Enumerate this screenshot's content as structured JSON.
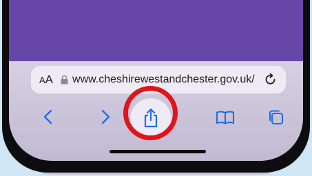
{
  "address_bar": {
    "text_size_small": "A",
    "text_size_large": "A",
    "url": "www.cheshirewestandchester.gov.uk/"
  },
  "toolbar": {
    "buttons": [
      "back",
      "forward",
      "share",
      "bookmarks",
      "tabs"
    ]
  },
  "colors": {
    "accent": "#1f6fe8",
    "page_purple": "#6647a8",
    "highlight_ring": "#e0141b"
  },
  "icons": [
    "lock-icon",
    "reload-icon",
    "back-chevron-icon",
    "forward-chevron-icon",
    "share-icon",
    "bookmarks-icon",
    "tabs-icon"
  ]
}
